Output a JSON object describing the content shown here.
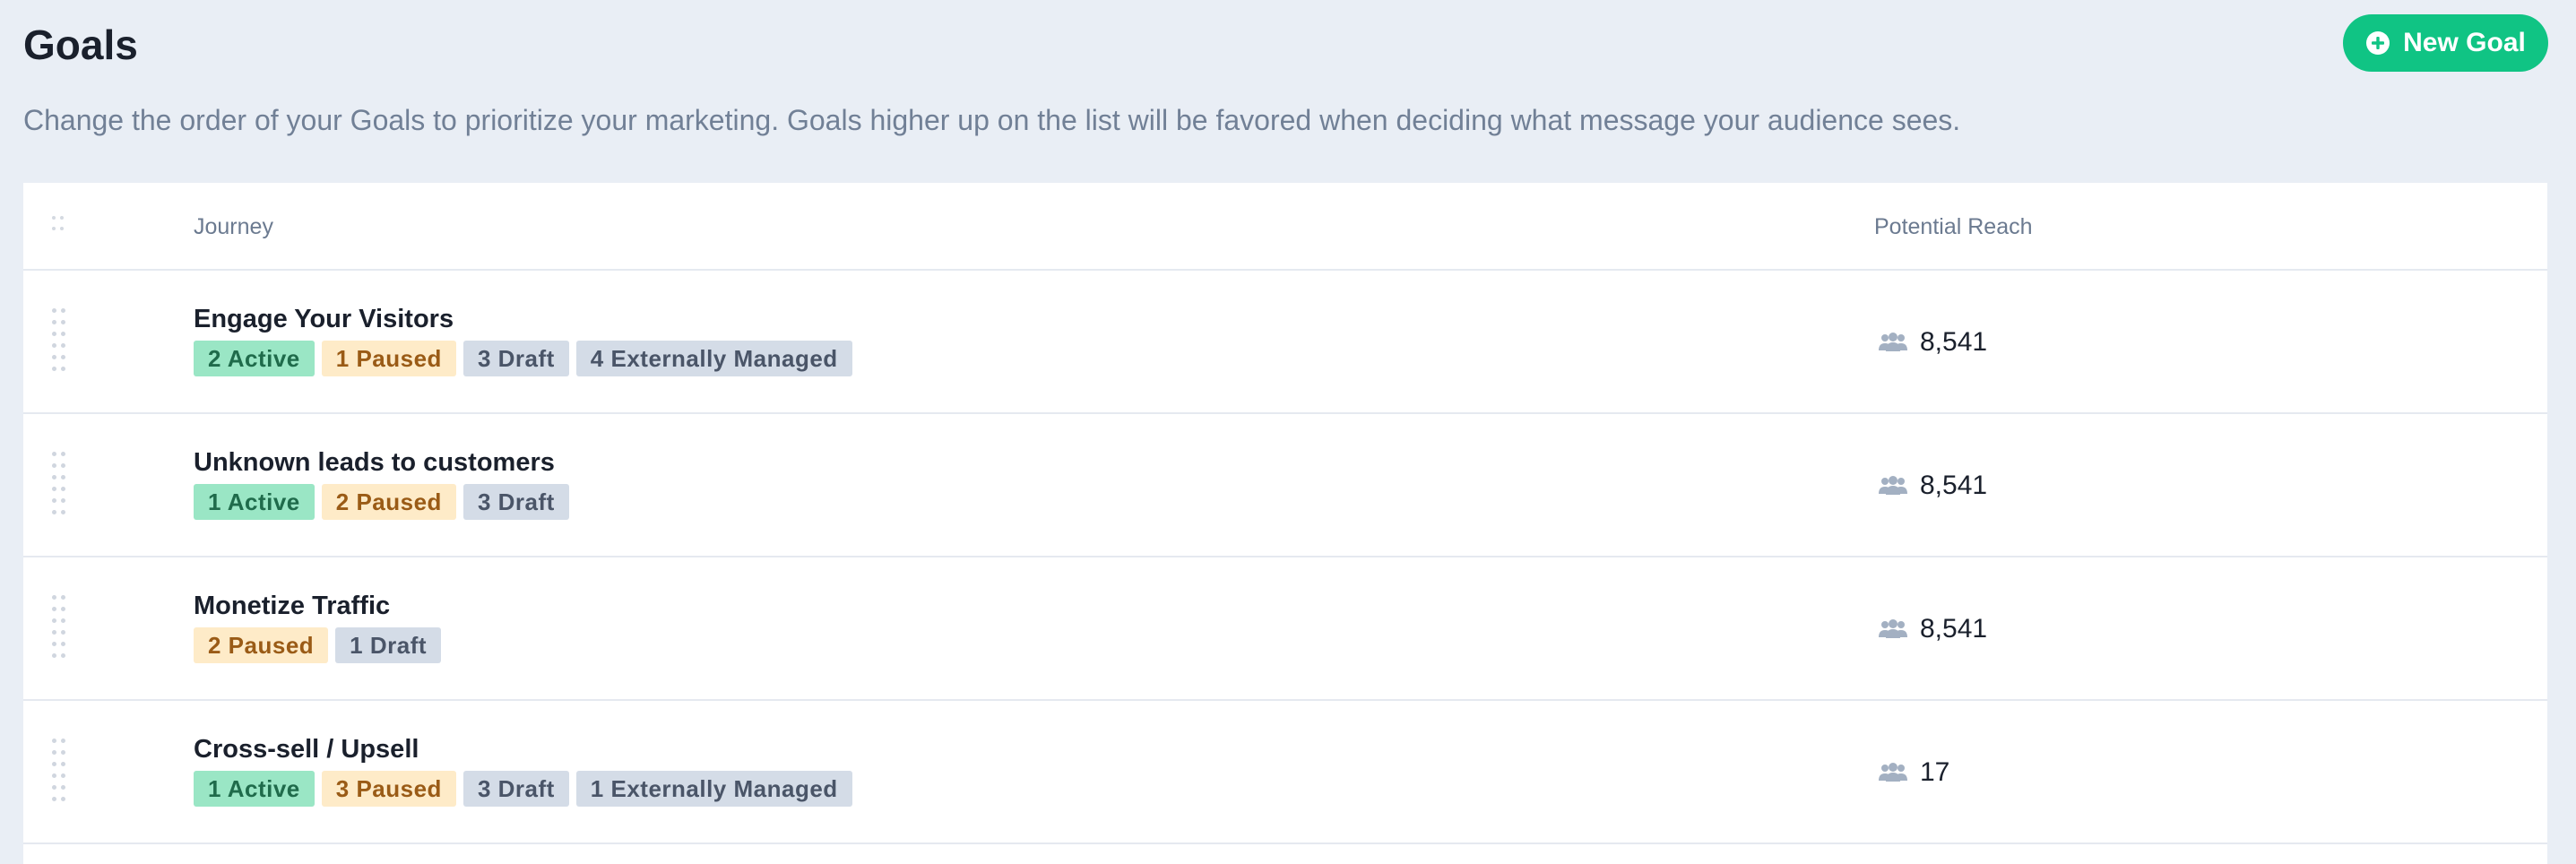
{
  "header": {
    "title": "Goals",
    "new_goal_label": "New Goal",
    "new_goal_icon": "plus-circle-icon",
    "subtitle": "Change the order of your Goals to prioritize your marketing. Goals higher up on the list will be favored when deciding what message your audience sees.",
    "accent_color": "#10c484"
  },
  "table": {
    "columns": {
      "journey": "Journey",
      "reach": "Potential Reach"
    },
    "rows": [
      {
        "name": "Engage Your Visitors",
        "badges": [
          {
            "label": "2 Active",
            "kind": "active"
          },
          {
            "label": "1 Paused",
            "kind": "paused"
          },
          {
            "label": "3 Draft",
            "kind": "draft"
          },
          {
            "label": "4 Externally Managed",
            "kind": "external"
          }
        ],
        "reach": "8,541"
      },
      {
        "name": "Unknown leads to customers",
        "badges": [
          {
            "label": "1 Active",
            "kind": "active"
          },
          {
            "label": "2 Paused",
            "kind": "paused"
          },
          {
            "label": "3 Draft",
            "kind": "draft"
          }
        ],
        "reach": "8,541"
      },
      {
        "name": "Monetize Traffic",
        "badges": [
          {
            "label": "2 Paused",
            "kind": "paused"
          },
          {
            "label": "1 Draft",
            "kind": "draft"
          }
        ],
        "reach": "8,541"
      },
      {
        "name": "Cross-sell / Upsell",
        "badges": [
          {
            "label": "1 Active",
            "kind": "active"
          },
          {
            "label": "3 Paused",
            "kind": "paused"
          },
          {
            "label": "3 Draft",
            "kind": "draft"
          },
          {
            "label": "1 Externally Managed",
            "kind": "external"
          }
        ],
        "reach": "17"
      }
    ]
  },
  "colors": {
    "active_bg": "#9ae6c5",
    "paused_bg": "#feebc8",
    "draft_bg": "#d4dce7",
    "page_bg": "#e9eef5"
  }
}
